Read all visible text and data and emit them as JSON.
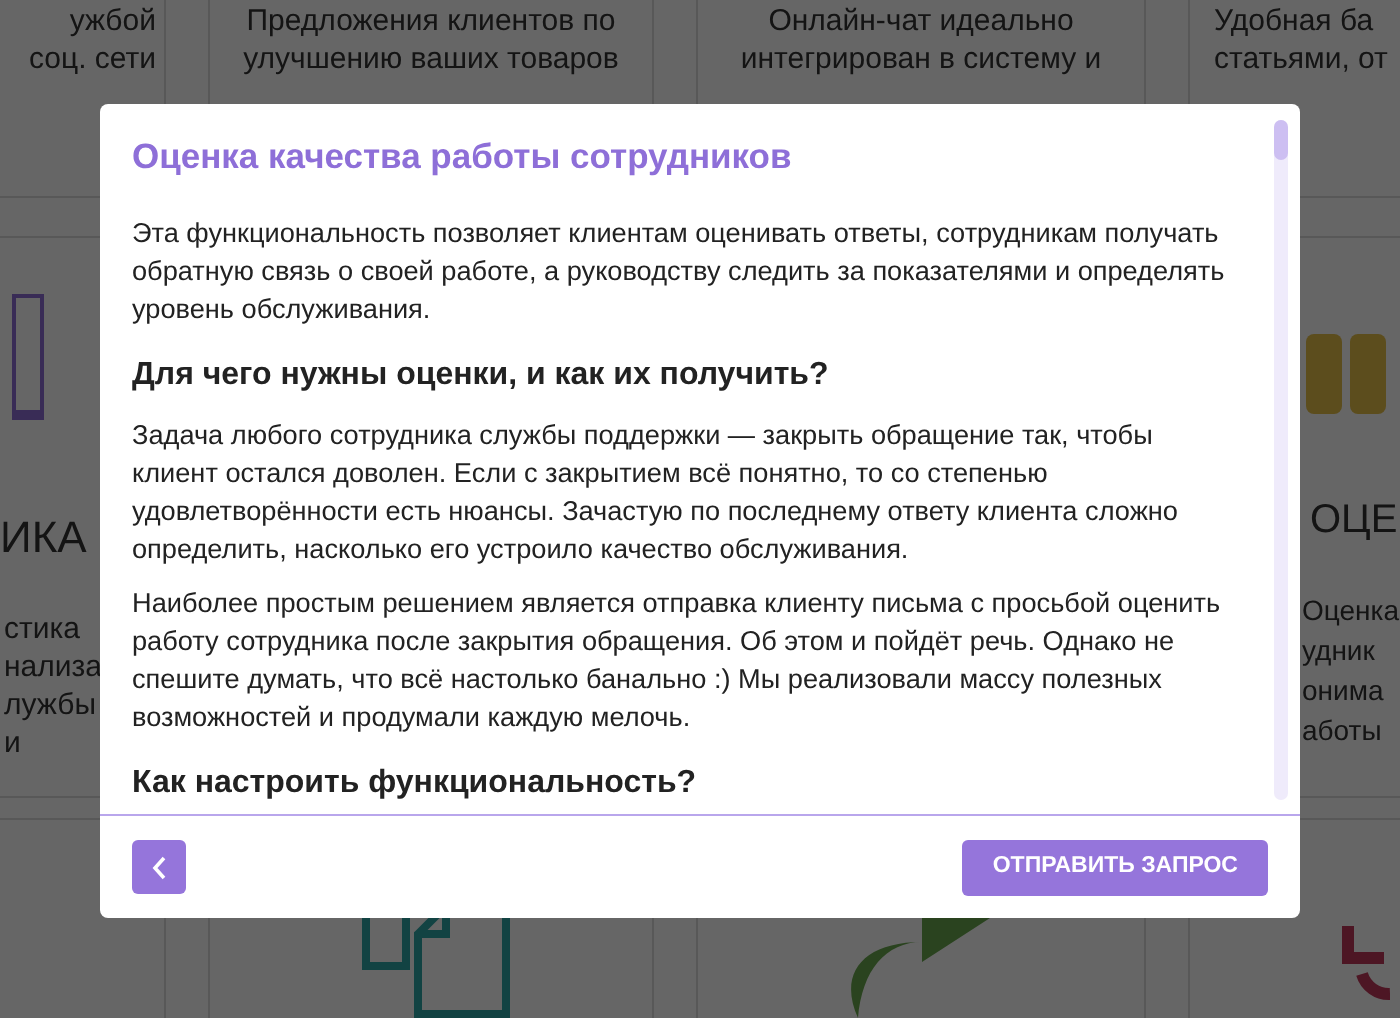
{
  "background": {
    "top_row": [
      {
        "lines": [
          "ужбой",
          "соц. сети"
        ]
      },
      {
        "lines": [
          "Предложения клиентов по",
          "улучшению ваших товаров"
        ]
      },
      {
        "lines": [
          "Онлайн-чат идеально",
          "интегрирован в систему и"
        ]
      },
      {
        "lines": [
          "Удобная ба",
          "статьями, от"
        ]
      }
    ],
    "middle_row": [
      {
        "title": "ИКА",
        "lines": [
          "стика",
          "нализа",
          "лужбы",
          "и"
        ]
      },
      {
        "title": "ОЦЕ",
        "lines": [
          "Оценка",
          "удник",
          "онима",
          "аботы"
        ]
      }
    ]
  },
  "modal": {
    "title": "Оценка качества работы сотрудников",
    "content": [
      {
        "kind": "paragraph",
        "text": "Эта функциональность позволяет клиентам оценивать ответы, сотрудникам получать обратную связь о своей работе, а руководству следить за показателями и определять уровень обслуживания."
      },
      {
        "kind": "heading",
        "text": "Для чего нужны оценки, и как их получить?"
      },
      {
        "kind": "paragraph",
        "text": "Задача любого сотрудника службы поддержки — закрыть обращение так, чтобы клиент остался доволен. Если с закрытием всё понятно, то со степенью удовлетворённости есть нюансы. Зачастую по последнему ответу клиента сложно определить, насколько его устроило качество обслуживания."
      },
      {
        "kind": "paragraph",
        "text": "Наиболее простым решением является отправка клиенту письма с просьбой оценить работу сотрудника после закрытия обращения. Об этом и пойдёт речь. Однако не спешите думать, что всё настолько банально :) Мы реализовали массу полезных возможностей и продумали каждую мелочь."
      },
      {
        "kind": "heading",
        "text": "Как настроить функциональность?"
      }
    ],
    "submit_button": "ОТПРАВИТЬ ЗАПРОС"
  }
}
